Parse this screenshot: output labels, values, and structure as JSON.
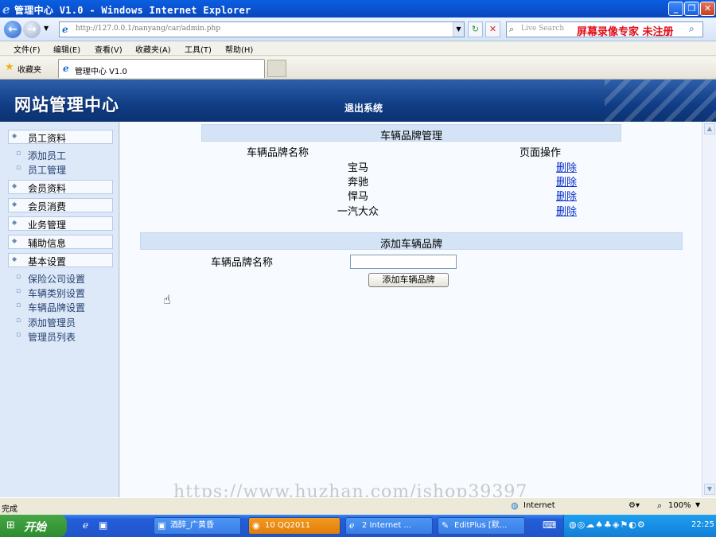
{
  "browser": {
    "window_title": "管理中心 V1.0 - Windows Internet Explorer",
    "url": "http://127.0.0.1/nanyang/car/admin.php",
    "search_placeholder": "Live Search",
    "watermark_overlay": "屏幕录像专家 未注册",
    "menu": [
      "文件(F)",
      "编辑(E)",
      "查看(V)",
      "收藏夹(A)",
      "工具(T)",
      "帮助(H)"
    ],
    "favorites_label": "收藏夹",
    "tab_title": "管理中心 V1.0",
    "status_text": "完成",
    "zone_text": "Internet",
    "zoom_text": "100%"
  },
  "site": {
    "logo_text": "网站管理中心",
    "logout_label": "退出系统"
  },
  "sidebar": {
    "cat_staff": "员工资料",
    "item_add_staff": "添加员工",
    "item_manage_staff": "员工管理",
    "cat_member": "会员资料",
    "cat_member_spend": "会员消费",
    "cat_business": "业务管理",
    "cat_aux": "辅助信息",
    "cat_basic": "基本设置",
    "item_insurance": "保险公司设置",
    "item_vehicle_type": "车辆类别设置",
    "item_vehicle_brand": "车辆品牌设置",
    "item_add_admin": "添加管理员",
    "item_admin_list": "管理员列表"
  },
  "main": {
    "panel_title": "车辆品牌管理",
    "col_brand_name": "车辆品牌名称",
    "col_actions": "页面操作",
    "delete_label": "删除",
    "brands": [
      "宝马",
      "奔驰",
      "悍马",
      "一汽大众"
    ],
    "add_panel_title": "添加车辆品牌",
    "add_field_label": "车辆品牌名称",
    "add_field_value": "",
    "add_button_label": "添加车辆品牌"
  },
  "footer_watermark": "https://www.huzhan.com/ishop39397",
  "taskbar": {
    "start_label": "开始",
    "tasks": [
      "酒醉_广黄昏",
      "10 QQ2011",
      "2 Internet ...",
      "EditPlus [默..."
    ],
    "clock": "22:25"
  }
}
